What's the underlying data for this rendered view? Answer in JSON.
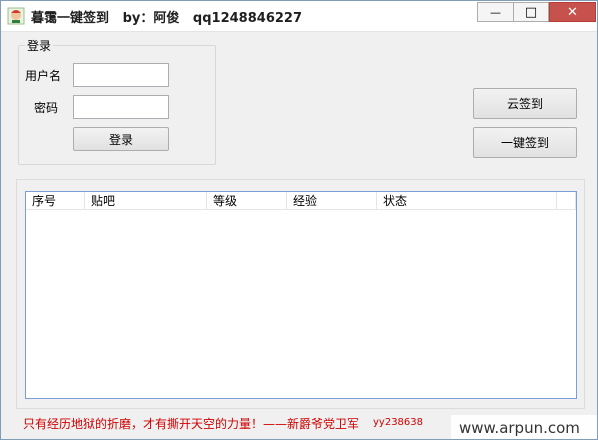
{
  "window": {
    "title": "暮霭一键签到   by：阿俊   qq1248846227",
    "minimize_symbol": "—",
    "maximize_symbol": "□",
    "close_symbol": "✕"
  },
  "login_group": {
    "title": "登录",
    "username_label": "用户名",
    "username_value": "",
    "password_label": "密码",
    "password_value": "",
    "login_button": "登录"
  },
  "actions": {
    "cloud_checkin_button": "云签到",
    "one_click_checkin_button": "一键签到"
  },
  "table": {
    "columns": [
      "序号",
      "贴吧",
      "等级",
      "经验",
      "状态"
    ],
    "rows": []
  },
  "footer": {
    "slogan": "只有经历地狱的折磨，才有撕开天空的力量！——新爵爷党卫军",
    "code": "yy238638"
  },
  "watermark": "www.arpun.com",
  "colors": {
    "footer_text": "#d10000",
    "close_button": "#c7514c",
    "list_border": "#7a9ed6"
  },
  "icons": {
    "app": "app-avatar-icon"
  }
}
